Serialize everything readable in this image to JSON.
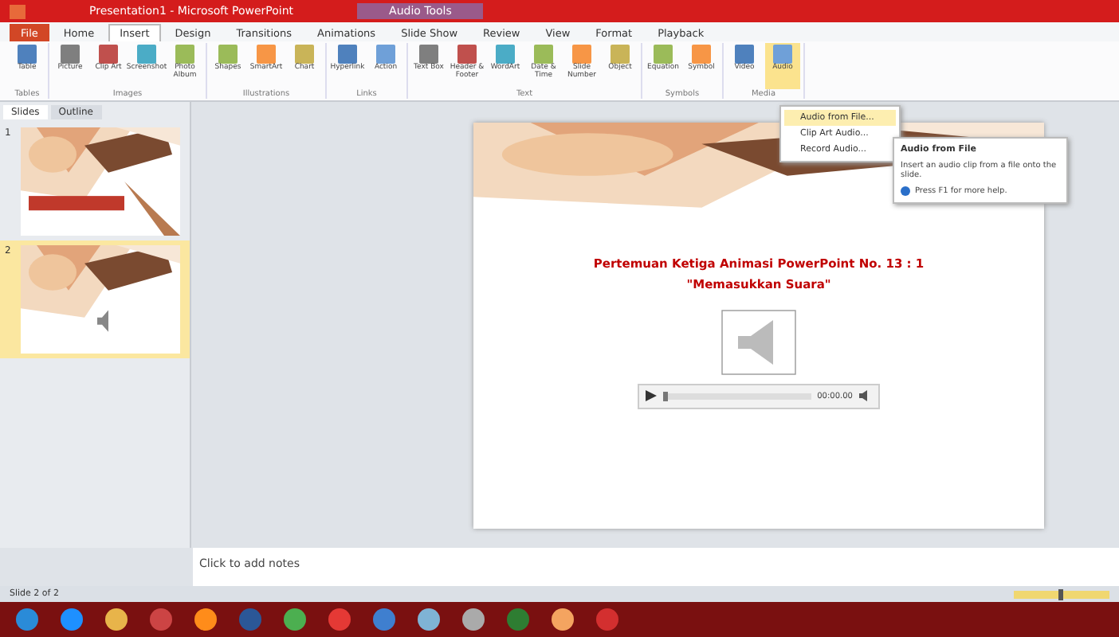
{
  "window": {
    "title": "Presentation1 - Microsoft PowerPoint",
    "context_title": "Audio Tools"
  },
  "tabs": [
    {
      "label": "File",
      "selected": false,
      "kind": "file"
    },
    {
      "label": "Home",
      "selected": false
    },
    {
      "label": "Insert",
      "selected": true
    },
    {
      "label": "Design",
      "selected": false
    },
    {
      "label": "Transitions",
      "selected": false
    },
    {
      "label": "Animations",
      "selected": false
    },
    {
      "label": "Slide Show",
      "selected": false
    },
    {
      "label": "Review",
      "selected": false
    },
    {
      "label": "View",
      "selected": false
    },
    {
      "label": "Format",
      "selected": false
    },
    {
      "label": "Playback",
      "selected": false
    }
  ],
  "ribbon": [
    {
      "label": "Tables",
      "buttons": [
        {
          "label": "Table",
          "selected": false
        }
      ]
    },
    {
      "label": "Images",
      "buttons": [
        {
          "label": "Picture",
          "selected": false
        },
        {
          "label": "Clip Art",
          "selected": false
        },
        {
          "label": "Screenshot",
          "selected": false
        },
        {
          "label": "Photo Album",
          "selected": false
        }
      ]
    },
    {
      "label": "Illustrations",
      "buttons": [
        {
          "label": "Shapes",
          "selected": false
        },
        {
          "label": "SmartArt",
          "selected": false
        },
        {
          "label": "Chart",
          "selected": false
        }
      ]
    },
    {
      "label": "Links",
      "buttons": [
        {
          "label": "Hyperlink",
          "selected": false
        },
        {
          "label": "Action",
          "selected": false
        }
      ]
    },
    {
      "label": "Text",
      "buttons": [
        {
          "label": "Text Box",
          "selected": false
        },
        {
          "label": "Header & Footer",
          "selected": false
        },
        {
          "label": "WordArt",
          "selected": false
        },
        {
          "label": "Date & Time",
          "selected": false
        },
        {
          "label": "Slide Number",
          "selected": false
        },
        {
          "label": "Object",
          "selected": false
        }
      ]
    },
    {
      "label": "Symbols",
      "buttons": [
        {
          "label": "Equation",
          "selected": false
        },
        {
          "label": "Symbol",
          "selected": false
        }
      ]
    },
    {
      "label": "Media",
      "buttons": [
        {
          "label": "Video",
          "selected": false
        },
        {
          "label": "Audio",
          "selected": true
        }
      ]
    }
  ],
  "audio_menu": [
    {
      "label": "Audio from File...",
      "selected": true
    },
    {
      "label": "Clip Art Audio...",
      "selected": false
    },
    {
      "label": "Record Audio...",
      "selected": false
    }
  ],
  "tooltip": {
    "title": "Audio from File",
    "text": "Insert an audio clip from a file onto the slide.",
    "help": "Press F1 for more help."
  },
  "panel": {
    "tabs": [
      {
        "label": "Slides",
        "selected": true
      },
      {
        "label": "Outline",
        "selected": false
      }
    ],
    "slides": [
      {
        "number": "1",
        "selected": false,
        "kind": "title"
      },
      {
        "number": "2",
        "selected": true,
        "kind": "audio"
      }
    ]
  },
  "slide": {
    "title": "Pertemuan Ketiga Animasi PowerPoint No. 13 : 1",
    "subtitle": "\"Memasukkan Suara\""
  },
  "player": {
    "time": "00:00.00",
    "level": 0
  },
  "notes": {
    "placeholder": "Click to add notes"
  },
  "status_bar": {
    "text": "Slide 2 of 2",
    "zoom": {
      "level": 0.5
    }
  }
}
